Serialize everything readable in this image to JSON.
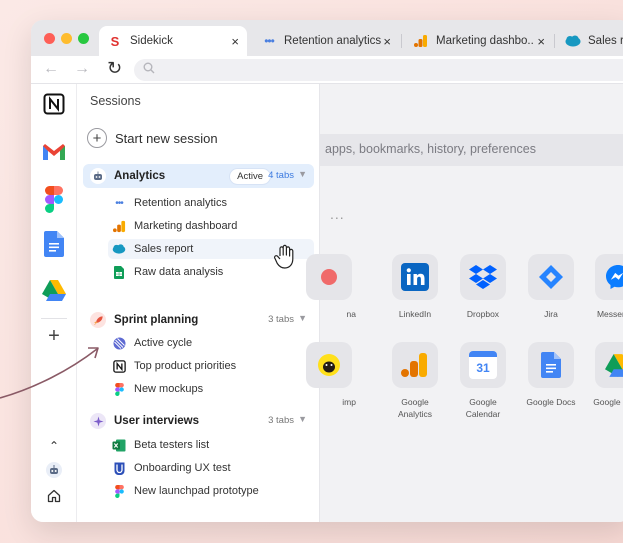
{
  "browser": {
    "tabs": [
      {
        "title": "Sidekick",
        "icon": "sidekick-icon",
        "active": true
      },
      {
        "title": "Retention analytics",
        "icon": "dots-icon"
      },
      {
        "title": "Marketing dashbo..",
        "icon": "analytics-icon"
      },
      {
        "title": "Sales re",
        "icon": "salesforce-icon"
      }
    ],
    "close_glyph": "×"
  },
  "sessions": {
    "title": "Sessions",
    "new_session": "Start new session",
    "groups": [
      {
        "name": "Analytics",
        "badge": "Active",
        "tabs": "4 tabs",
        "active": true,
        "items": [
          "Retention analytics",
          "Marketing dashboard",
          "Sales report",
          "Raw data analysis"
        ]
      },
      {
        "name": "Sprint planning",
        "tabs": "3 tabs",
        "items": [
          "Active cycle",
          "Top product priorities",
          "New mockups"
        ]
      },
      {
        "name": "User interviews",
        "tabs": "3 tabs",
        "items": [
          "Beta testers list",
          "Onboarding UX test",
          "New launchpad prototype"
        ]
      }
    ]
  },
  "main": {
    "search_placeholder": "apps, bookmarks, history, preferences",
    "more": "...",
    "apps_row1": [
      {
        "label": "na",
        "icon": "partial-app-icon"
      },
      {
        "label": "LinkedIn",
        "icon": "linkedin-icon"
      },
      {
        "label": "Dropbox",
        "icon": "dropbox-icon"
      },
      {
        "label": "Jira",
        "icon": "jira-icon"
      },
      {
        "label": "Messenger",
        "icon": "messenger-icon"
      }
    ],
    "apps_row2": [
      {
        "label": "imp",
        "icon": "mailchimp-icon"
      },
      {
        "label": "Google Analytics",
        "icon": "google-analytics-icon"
      },
      {
        "label": "Google Calendar",
        "icon": "google-calendar-icon"
      },
      {
        "label": "Google Docs",
        "icon": "google-docs-icon"
      },
      {
        "label": "Google Drive",
        "icon": "google-drive-icon"
      }
    ],
    "calendar_day": "31"
  },
  "colors": {
    "accent": "#3d7be0",
    "active_group_bg": "#e3eefc",
    "arrow": "#8a5a66"
  }
}
